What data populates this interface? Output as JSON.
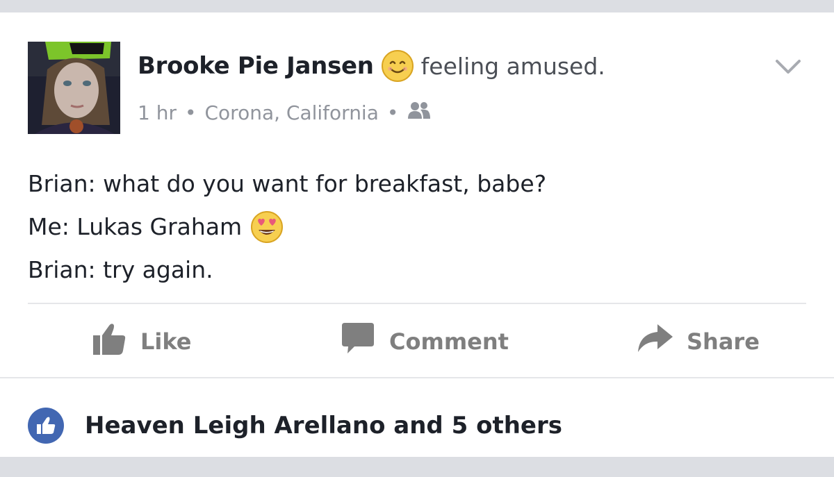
{
  "post": {
    "author": "Brooke Pie Jansen",
    "feeling_emoji": "smiling-face-icon",
    "feeling": "feeling amused.",
    "time": "1 hr",
    "separator": "•",
    "location": "Corona, California",
    "audience_icon": "friends-icon",
    "menu_icon": "chevron-down-icon",
    "lines": [
      "Brian: what do you want for breakfast, babe?",
      "Me: Lukas Graham",
      "Brian: try again."
    ],
    "inline_emoji": "heart-eyes-emoji-icon"
  },
  "actions": {
    "like": "Like",
    "comment": "Comment",
    "share": "Share"
  },
  "reactions": {
    "summary": "Heaven Leigh Arellano and 5 others"
  },
  "colors": {
    "card": "#ffffff",
    "page": "#dcdee3",
    "text": "#1d2129",
    "meta": "#90949c",
    "action": "#7f7f7f",
    "like_blue": "#4267b2"
  }
}
